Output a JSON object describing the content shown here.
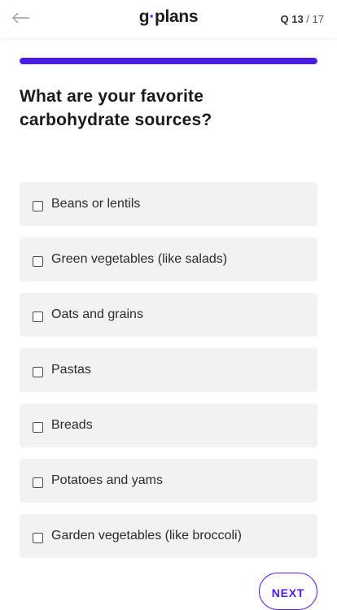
{
  "header": {
    "logo_prefix": "g",
    "logo_dot": "·",
    "logo_suffix": "plans",
    "question_current": "Q 13",
    "question_separator": " / ",
    "question_total": "17"
  },
  "progress": {
    "fraction": 1.0
  },
  "question": {
    "text": "What are your favorite carbohydrate sources?"
  },
  "options": [
    {
      "label": "Beans or lentils",
      "checked": false
    },
    {
      "label": "Green vegetables (like salads)",
      "checked": false
    },
    {
      "label": "Oats and grains",
      "checked": false
    },
    {
      "label": "Pastas",
      "checked": false
    },
    {
      "label": "Breads",
      "checked": false
    },
    {
      "label": "Potatoes and yams",
      "checked": false
    },
    {
      "label": "Garden vegetables (like broccoli)",
      "checked": false
    }
  ],
  "footer": {
    "next_label": "NEXT"
  },
  "colors": {
    "accent": "#4b1ce8",
    "option_bg": "#f1f2f4"
  },
  "icons": {
    "back": "arrow-left-icon"
  }
}
